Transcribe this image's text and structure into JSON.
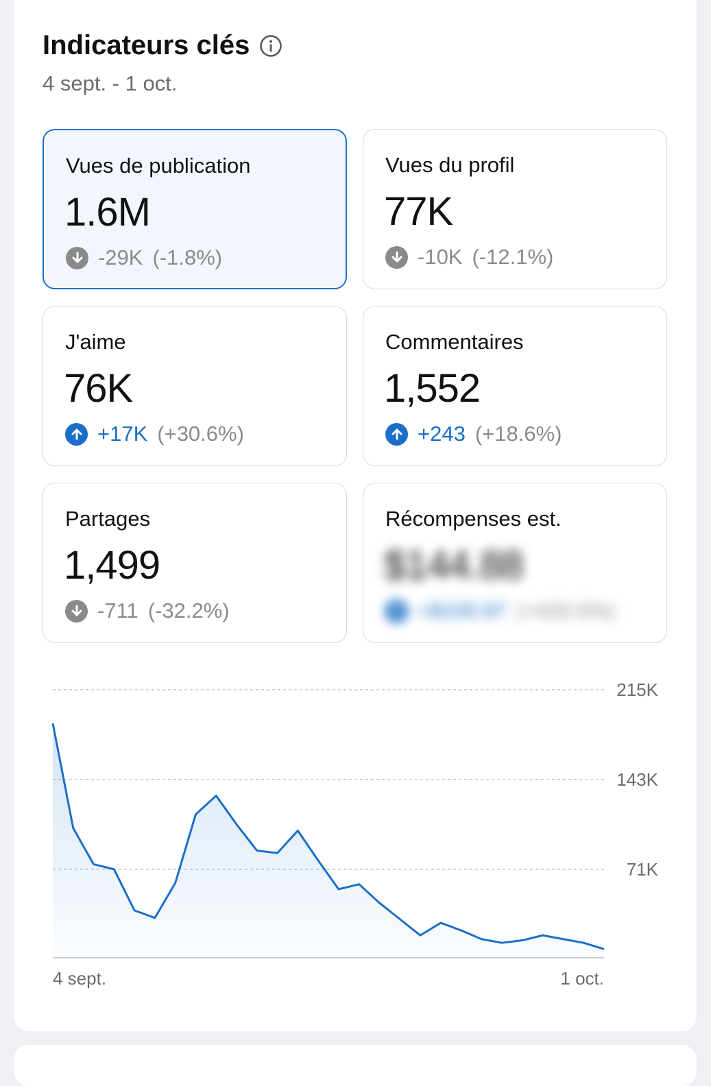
{
  "header": {
    "title": "Indicateurs clés",
    "date_range": "4 sept. - 1 oct."
  },
  "metrics": [
    {
      "label": "Vues de publication",
      "value": "1.6M",
      "delta": "-29K",
      "pct": "(-1.8%)",
      "direction": "down",
      "selected": true
    },
    {
      "label": "Vues du profil",
      "value": "77K",
      "delta": "-10K",
      "pct": "(-12.1%)",
      "direction": "down"
    },
    {
      "label": "J'aime",
      "value": "76K",
      "delta": "+17K",
      "pct": "(+30.6%)",
      "direction": "up"
    },
    {
      "label": "Commentaires",
      "value": "1,552",
      "delta": "+243",
      "pct": "(+18.6%)",
      "direction": "up"
    },
    {
      "label": "Partages",
      "value": "1,499",
      "delta": "-711",
      "pct": "(-32.2%)",
      "direction": "down"
    },
    {
      "label": "Récompenses est.",
      "value": "$144.88",
      "delta": "+$100.97",
      "pct": "(+420.5%)",
      "direction": "up",
      "blurred": true
    }
  ],
  "colors": {
    "accent": "#1a6fc9",
    "neutral": "#8a8a8a",
    "selected_bg": "#f3f7fd"
  },
  "chart_data": {
    "type": "area",
    "x_labels": [
      "4 sept.",
      "1 oct."
    ],
    "y_ticks": [
      "215K",
      "143K",
      "71K"
    ],
    "y_tick_values": [
      215000,
      143000,
      71000
    ],
    "ylim": [
      0,
      215000
    ],
    "grid": true,
    "values": [
      188000,
      104000,
      75000,
      71000,
      38000,
      32000,
      60000,
      115000,
      130000,
      107000,
      86000,
      84000,
      102000,
      78000,
      55000,
      59000,
      44000,
      31000,
      18000,
      28000,
      22000,
      15000,
      12000,
      14000,
      18000,
      15000,
      12000,
      7000
    ]
  }
}
